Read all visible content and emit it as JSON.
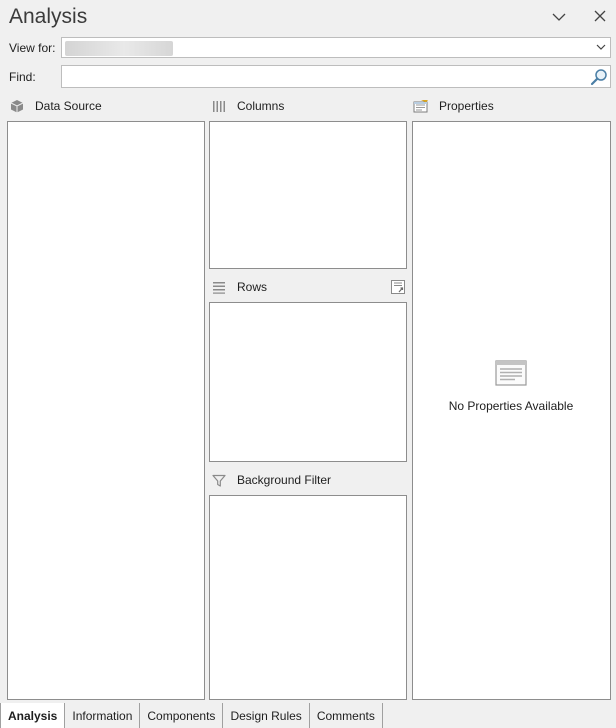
{
  "window": {
    "title": "Analysis"
  },
  "view_for": {
    "label": "View for:",
    "value": ""
  },
  "find": {
    "label": "Find:",
    "value": "",
    "placeholder": ""
  },
  "sections": {
    "data_source": "Data Source",
    "columns": "Columns",
    "rows": "Rows",
    "background_filter": "Background Filter",
    "properties": "Properties"
  },
  "properties_panel": {
    "empty_text": "No Properties Available"
  },
  "tabs": [
    {
      "label": "Analysis",
      "active": true
    },
    {
      "label": "Information",
      "active": false
    },
    {
      "label": "Components",
      "active": false
    },
    {
      "label": "Design Rules",
      "active": false
    },
    {
      "label": "Comments",
      "active": false
    }
  ],
  "icons": {
    "collapse": "chevron-down-icon",
    "close": "close-icon",
    "dropdown": "dropdown-arrow-icon",
    "search": "search-icon",
    "data_source": "cube-icon",
    "columns": "columns-icon",
    "rows": "rows-icon",
    "rows_action": "rows-settings-icon",
    "filter": "filter-icon",
    "properties": "properties-icon",
    "empty_properties": "document-icon"
  },
  "colors": {
    "background": "#f0f0f0",
    "panel": "#ffffff",
    "border": "#8d8d8d",
    "text": "#1e1e1e"
  }
}
